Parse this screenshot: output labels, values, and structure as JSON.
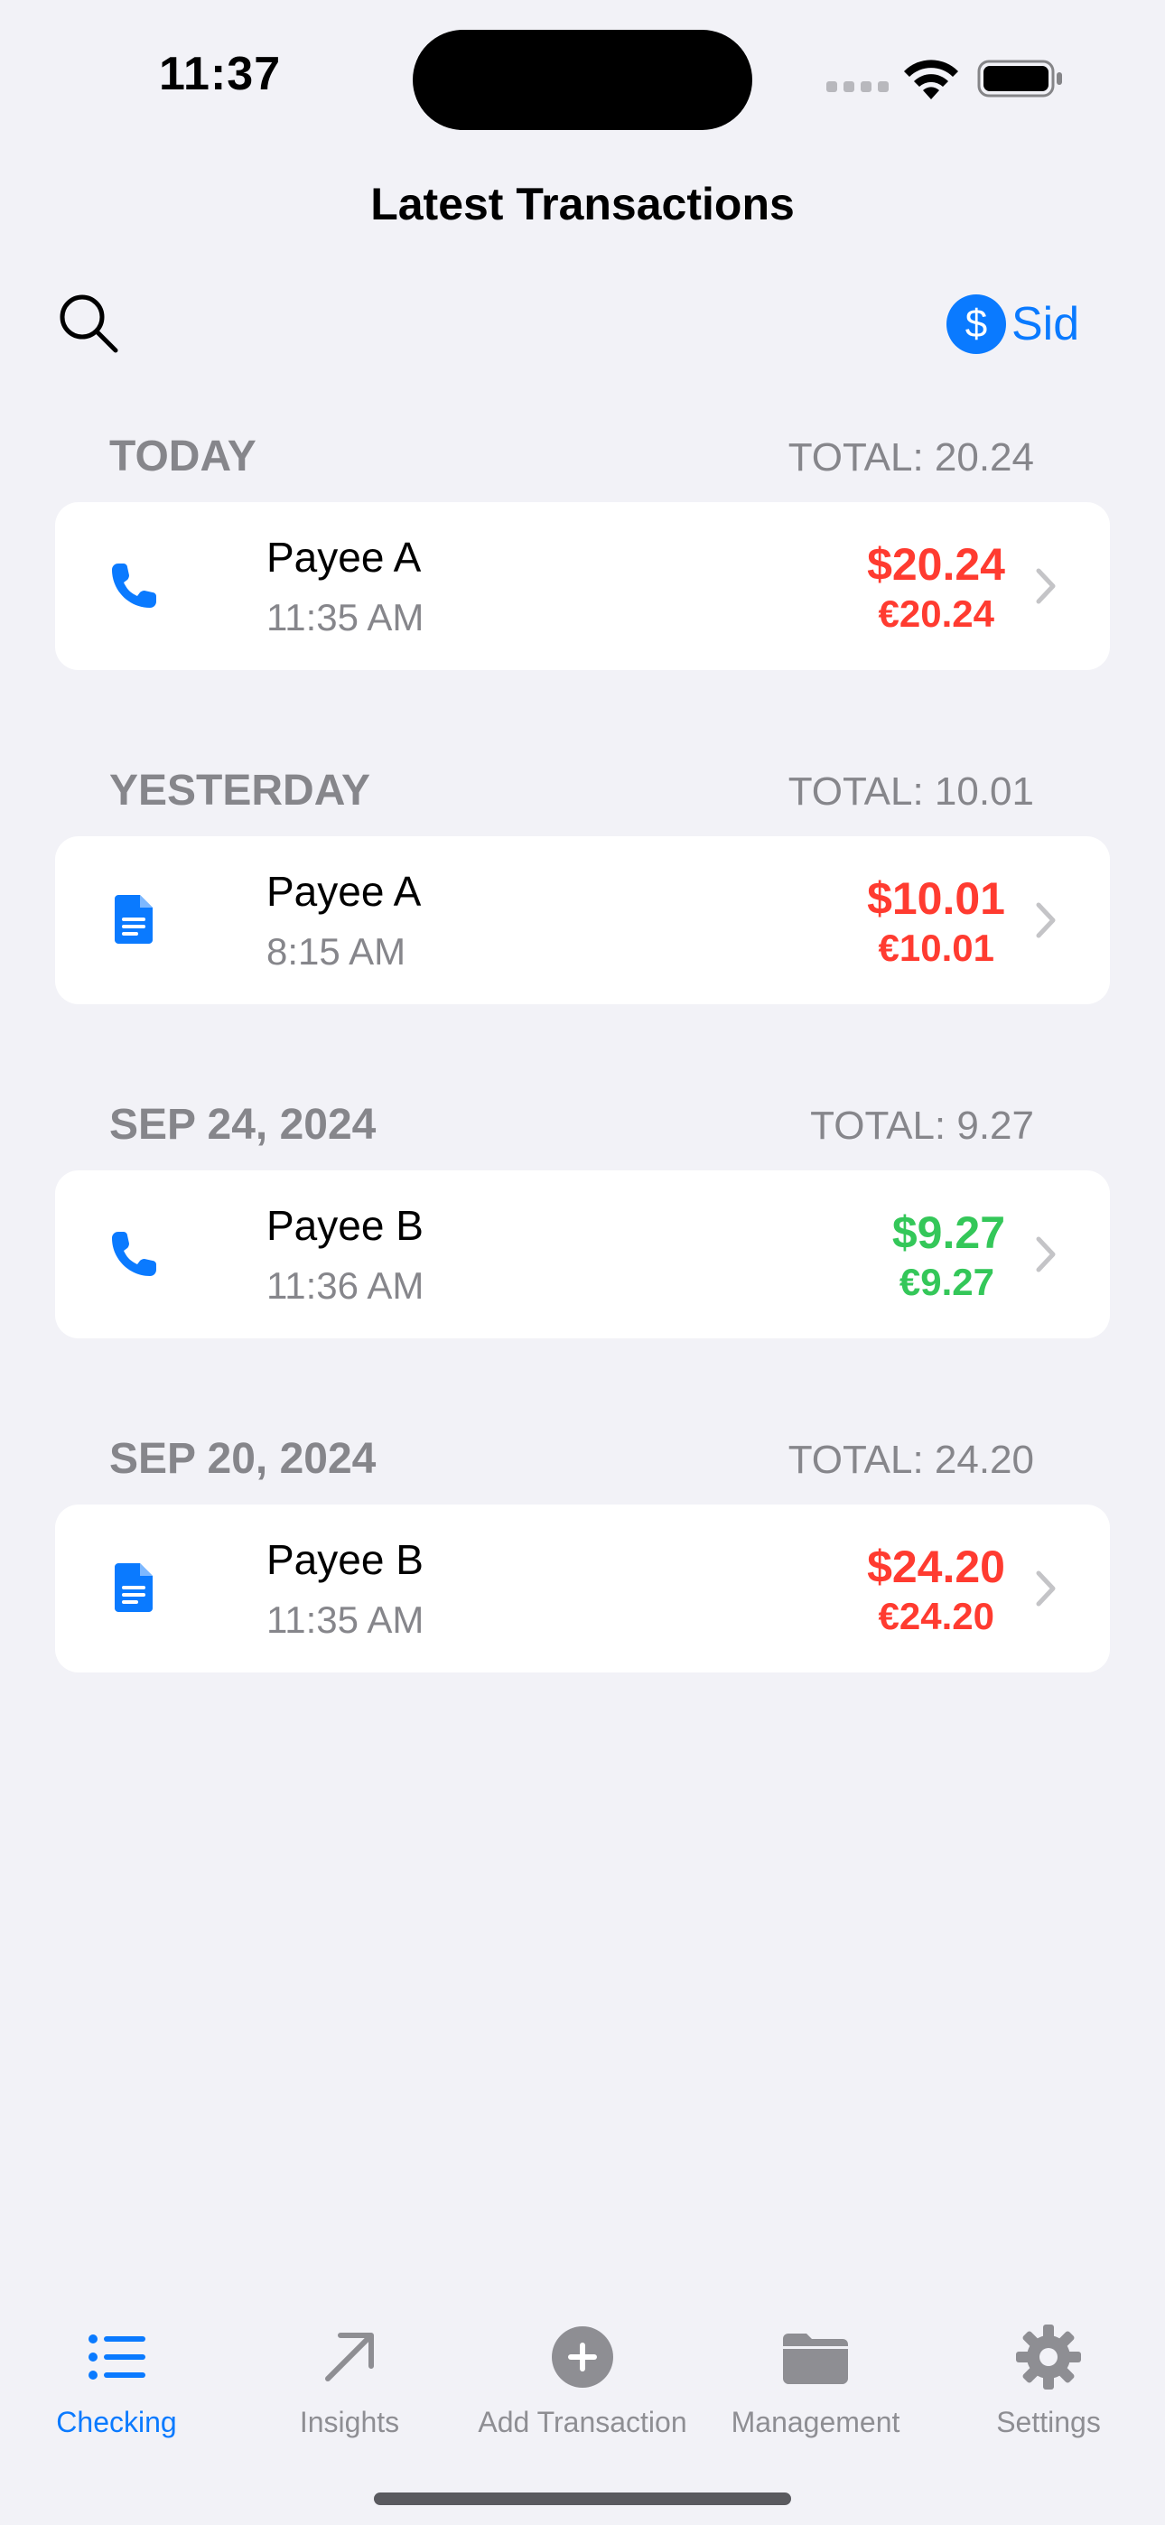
{
  "status_bar": {
    "time": "11:37"
  },
  "nav": {
    "title": "Latest Transactions",
    "account_symbol": "$",
    "account_name": "Sid"
  },
  "sections": [
    {
      "title": "TODAY",
      "total": "TOTAL: 20.24",
      "transaction": {
        "icon": "phone-icon",
        "payee": "Payee A",
        "time": "11:35 AM",
        "amount_usd": "$20.24",
        "amount_eur": "€20.24",
        "type": "expense"
      }
    },
    {
      "title": "YESTERDAY",
      "total": "TOTAL: 10.01",
      "transaction": {
        "icon": "document-icon",
        "payee": "Payee A",
        "time": "8:15 AM",
        "amount_usd": "$10.01",
        "amount_eur": "€10.01",
        "type": "expense"
      }
    },
    {
      "title": "SEP 24, 2024",
      "total": "TOTAL: 9.27",
      "transaction": {
        "icon": "phone-icon",
        "payee": "Payee B",
        "time": "11:36 AM",
        "amount_usd": "$9.27",
        "amount_eur": "€9.27",
        "type": "income"
      }
    },
    {
      "title": "SEP 20, 2024",
      "total": "TOTAL: 24.20",
      "transaction": {
        "icon": "document-icon",
        "payee": "Payee B",
        "time": "11:35 AM",
        "amount_usd": "$24.20",
        "amount_eur": "€24.20",
        "type": "expense"
      }
    }
  ],
  "tabbar": {
    "tabs": [
      {
        "label": "Checking",
        "icon": "list-icon",
        "active": true
      },
      {
        "label": "Insights",
        "icon": "arrow-up-right-icon",
        "active": false
      },
      {
        "label": "Add Transaction",
        "icon": "plus-circle-icon",
        "active": false
      },
      {
        "label": "Management",
        "icon": "folder-icon",
        "active": false
      },
      {
        "label": "Settings",
        "icon": "gear-icon",
        "active": false
      }
    ]
  },
  "colors": {
    "accent": "#0a7aff",
    "expense": "#ff3b30",
    "income": "#34c759",
    "secondary_text": "#86868b",
    "background": "#f2f2f7"
  }
}
